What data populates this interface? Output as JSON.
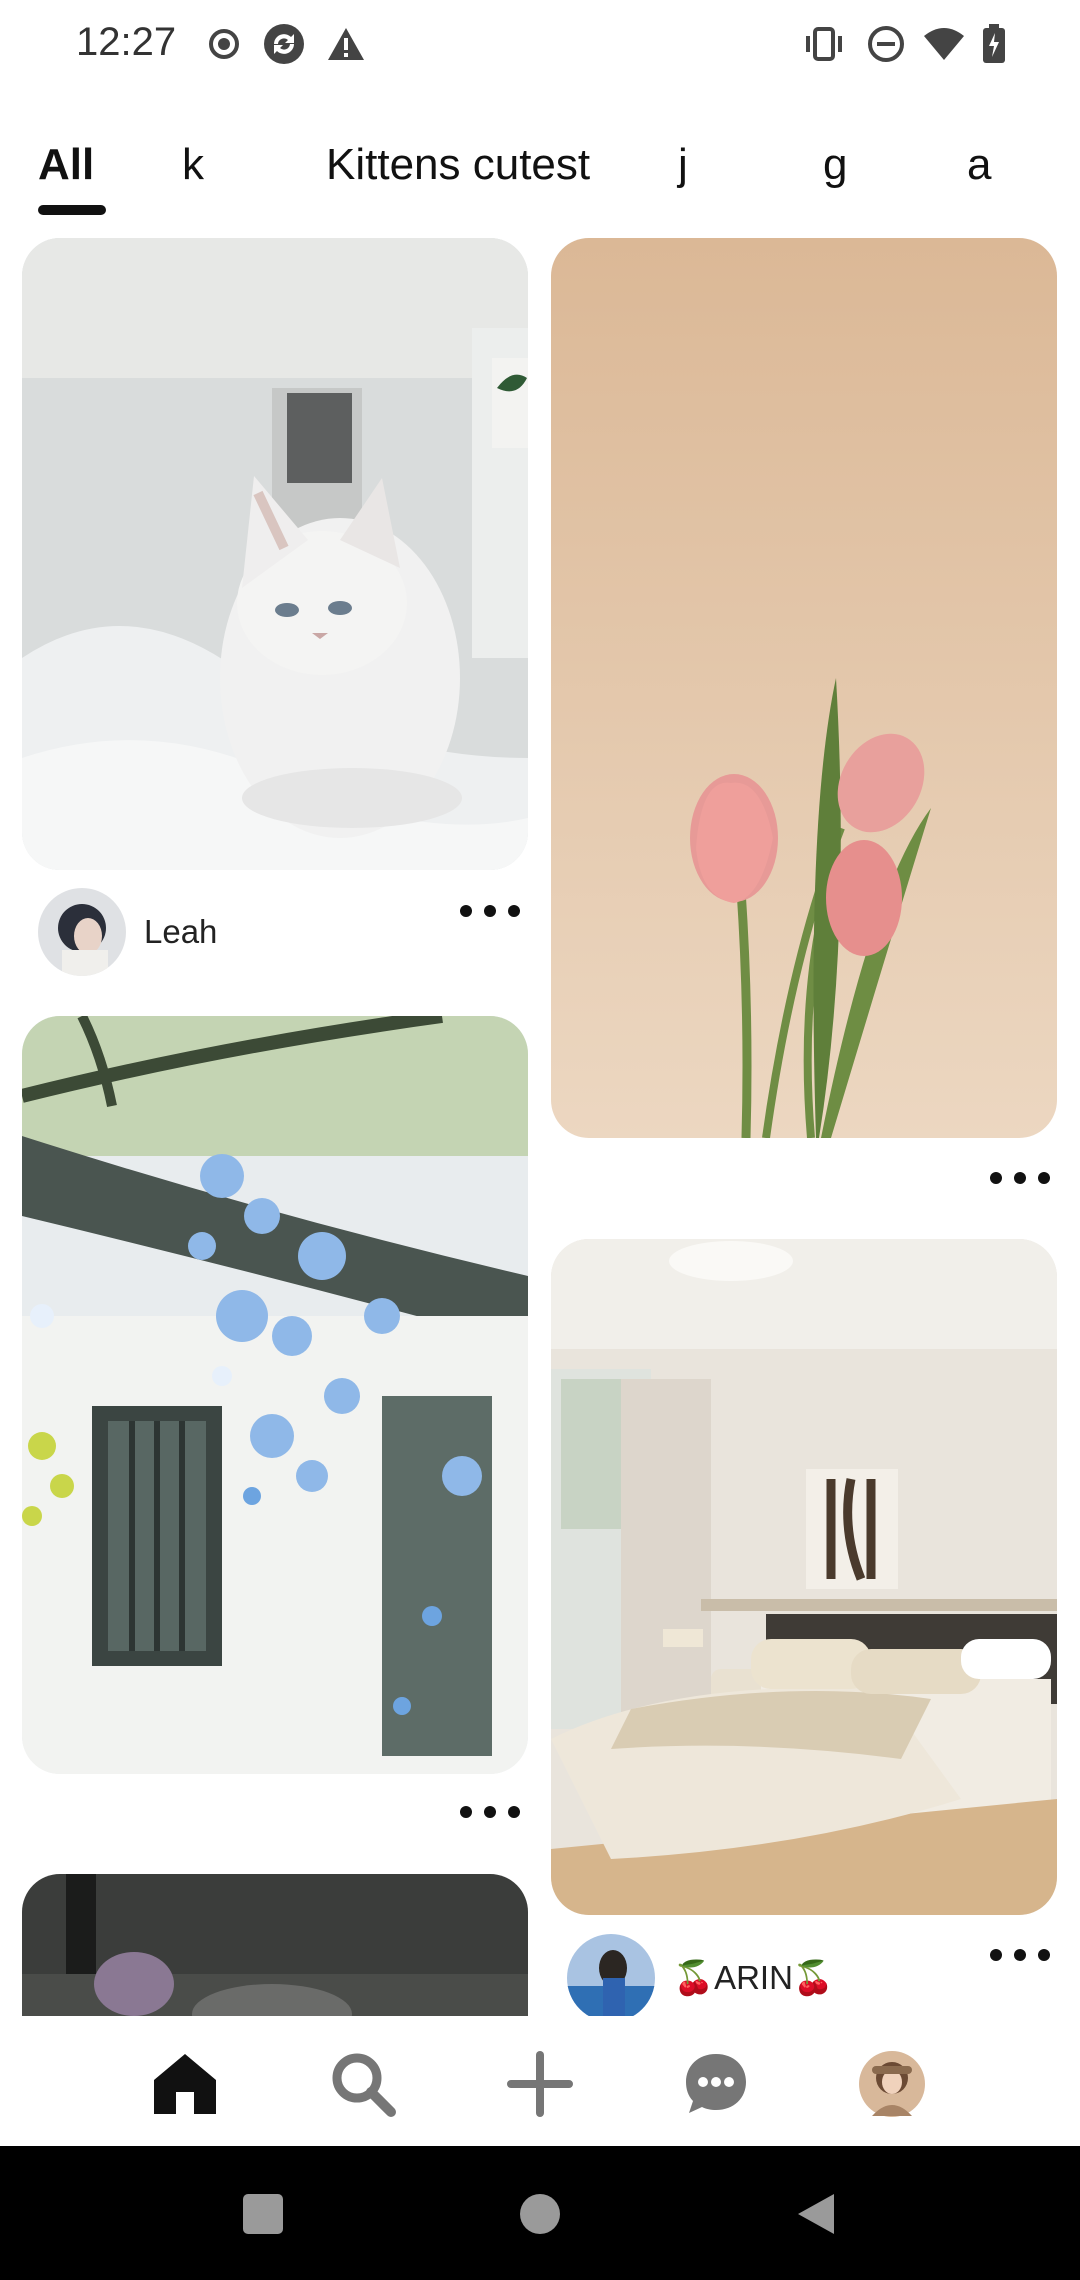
{
  "status_bar": {
    "time": "12:27",
    "left_icons": [
      "record-icon",
      "sync-icon",
      "warning-icon"
    ],
    "right_icons": [
      "vibrate-icon",
      "do-not-disturb-icon",
      "wifi-icon",
      "battery-charging-icon"
    ]
  },
  "tabs": [
    {
      "label": "All",
      "active": true
    },
    {
      "label": "k",
      "active": false
    },
    {
      "label": "Kittens cutest",
      "active": false
    },
    {
      "label": "j",
      "active": false
    },
    {
      "label": "g",
      "active": false
    },
    {
      "label": "a",
      "active": false
    }
  ],
  "pins": {
    "cat": {
      "author": "Leah"
    },
    "bedroom": {
      "author": "🍒ARIN🍒"
    }
  },
  "bottom_nav": [
    "home-icon",
    "search-icon",
    "create-plus-icon",
    "messages-icon",
    "profile-avatar"
  ],
  "system_nav": [
    "recents-square",
    "home-circle",
    "back-triangle"
  ],
  "colors": {
    "accent": "#111111",
    "background": "#ffffff"
  }
}
